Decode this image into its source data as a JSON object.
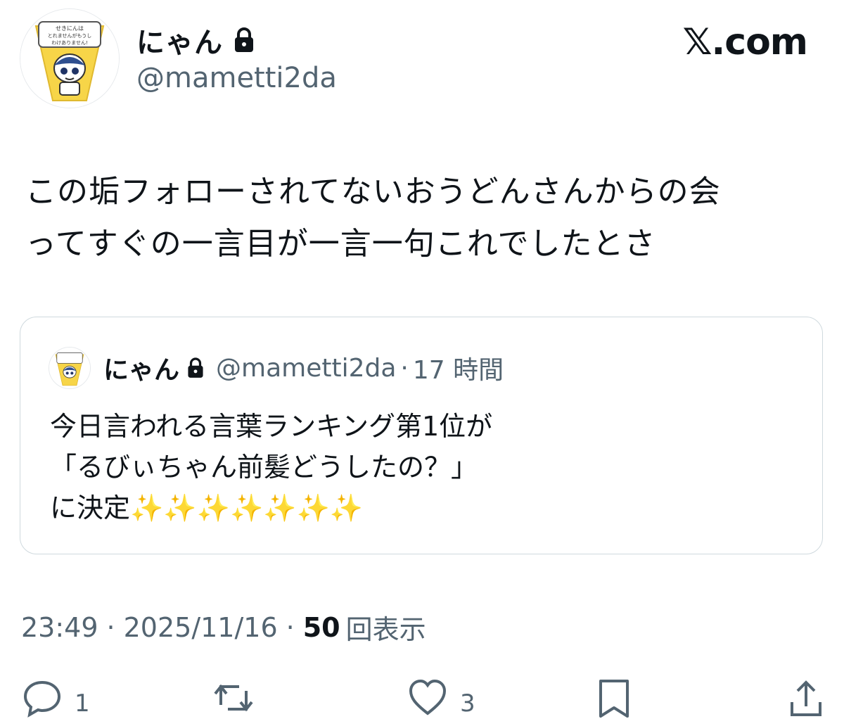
{
  "author": {
    "display_name": "にゃん",
    "handle": "@mametti2da",
    "avatar_text": "せきにんは とれませんがもうし わけありません!"
  },
  "brand": "𝕏.com",
  "tweet": {
    "text": "この垢フォローされてないおうどんさんからの会\nってすぐの一言目が一言一句これでしたとさ"
  },
  "quote": {
    "display_name": "にゃん",
    "handle": "@mametti2da",
    "separator": "·",
    "time": "17 時間",
    "text": "今日言われる言葉ランキング第1位が\n「るびぃちゃん前髪どうしたの？」\nに決定✨✨✨✨✨✨✨"
  },
  "meta": {
    "time": "23:49",
    "separator": "·",
    "date": "2025/11/16",
    "views_count": "50",
    "views_label": "回表示"
  },
  "actions": {
    "reply_count": "1",
    "like_count": "3"
  },
  "colors": {
    "text": "#0f1419",
    "secondary": "#536471",
    "border": "#cfd9de",
    "avatar_yellow": "#f7d548"
  }
}
